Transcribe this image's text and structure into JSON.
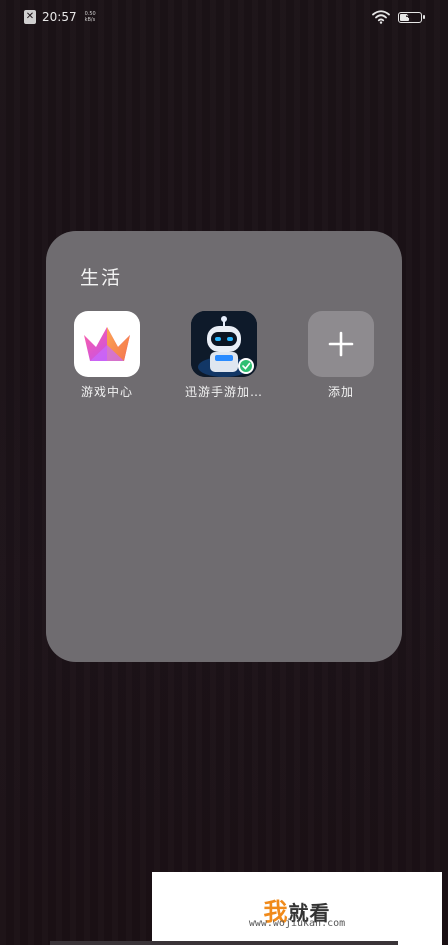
{
  "status_bar": {
    "time": "20:57",
    "net_speed_value": "0.50",
    "net_speed_unit": "kB/s",
    "battery_level": "40"
  },
  "folder": {
    "title": "生活",
    "apps": [
      {
        "label": "游戏中心",
        "icon": "game-center-crown-icon"
      },
      {
        "label": "迅游手游加…",
        "icon": "xunyou-robot-icon"
      },
      {
        "label": "添加",
        "icon": "plus-icon"
      }
    ]
  },
  "watermark": {
    "title_accent": "我",
    "title_rest": "就看",
    "url": "www.wojiukan.com"
  },
  "colors": {
    "folder_bg": "#6f6c70",
    "wallpaper": "#1b1216",
    "watermark_accent": "#f08a1a"
  }
}
